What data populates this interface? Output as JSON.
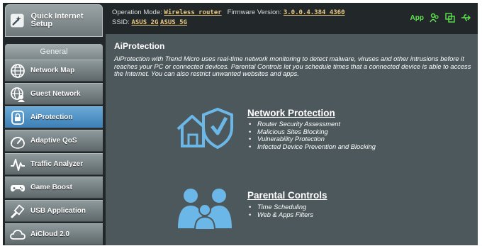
{
  "sidebar": {
    "quick_setup": "Quick Internet Setup",
    "general_header": "General",
    "items": [
      {
        "label": "Network Map",
        "icon": "globe-icon"
      },
      {
        "label": "Guest Network",
        "icon": "guest-globe-icon"
      },
      {
        "label": "AiProtection",
        "icon": "lock-icon",
        "active": true
      },
      {
        "label": "Adaptive QoS",
        "icon": "gauge-icon"
      },
      {
        "label": "Traffic Analyzer",
        "icon": "pulse-icon"
      },
      {
        "label": "Game Boost",
        "icon": "gamepad-icon"
      },
      {
        "label": "USB Application",
        "icon": "usb-icon"
      },
      {
        "label": "AiCloud 2.0",
        "icon": "cloud-icon"
      }
    ]
  },
  "header": {
    "operation_mode_label": "Operation Mode:",
    "operation_mode_value": "Wireless router",
    "firmware_label": "Firmware Version:",
    "firmware_value": "3.0.0.4.384_4360",
    "ssid_label": "SSID:",
    "ssid_2g": "ASUS_2G",
    "ssid_5g": "ASUS_5G",
    "app_label": "App",
    "accent_color": "#5fe34c",
    "link_color": "#e9c986"
  },
  "main": {
    "title": "AiProtection",
    "description": "AiProtection with Trend Micro uses real-time network monitoring to detect malware, viruses and other intrusions before it reaches your PC or connected devices. Parental Controls let you schedule times that a connected device is able to access the Internet. You can also restrict unwanted websites and apps.",
    "network_protection": {
      "title": "Network Protection",
      "items": [
        "Router Security Assessment",
        "Malicious Sites Blocking",
        "Vulnerability Protection",
        "Infected Device Prevention and Blocking"
      ]
    },
    "parental_controls": {
      "title": "Parental Controls",
      "items": [
        "Time Scheduling",
        "Web & Apps Filters"
      ]
    }
  },
  "colors": {
    "active_nav": "#3d7fb6",
    "content_bg": "#4d585c",
    "icon_blue": "#6bb8e8"
  }
}
